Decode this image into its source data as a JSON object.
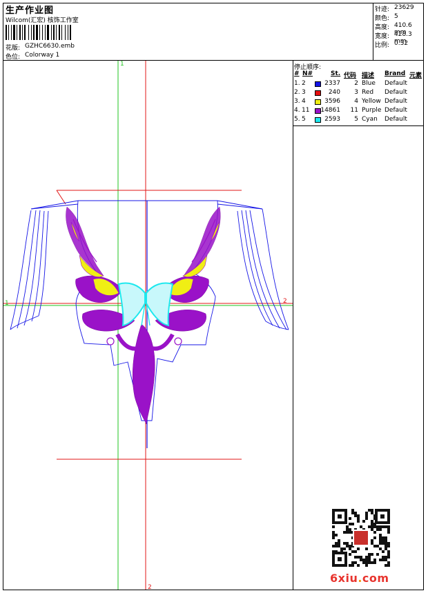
{
  "header": {
    "title": "生产作业图",
    "company": "Wilcom(汇宏) 核饰工作室",
    "design_label": "花版:",
    "design_value": "GZHC6630.emb",
    "colorway_label": "色位:",
    "colorway_value": "Colorway 1"
  },
  "stats": [
    {
      "label": "针迹:",
      "value": "23629"
    },
    {
      "label": "颜色:",
      "value": "5"
    },
    {
      "label": "高度:",
      "value": "410.6 mm"
    },
    {
      "label": "宽度:",
      "value": "428.3 mm"
    },
    {
      "label": "比例:",
      "value": "0.32"
    }
  ],
  "legend": {
    "title": "停止顺序:",
    "headers": {
      "num": "#",
      "n": "N#",
      "st": "St.",
      "code": "代码",
      "desc": "描述",
      "brand": "Brand",
      "element": "元素"
    },
    "rows": [
      {
        "num": "1.",
        "n": "2",
        "color": "#1414e6",
        "st": "2337",
        "code": "2",
        "desc": "Blue",
        "brand": "Default"
      },
      {
        "num": "2.",
        "n": "3",
        "color": "#e60f0f",
        "st": "240",
        "code": "3",
        "desc": "Red",
        "brand": "Default"
      },
      {
        "num": "3.",
        "n": "4",
        "color": "#f0ee14",
        "st": "3596",
        "code": "4",
        "desc": "Yellow",
        "brand": "Default"
      },
      {
        "num": "4.",
        "n": "11",
        "color": "#9a12c8",
        "st": "14861",
        "code": "11",
        "desc": "Purple",
        "brand": "Default"
      },
      {
        "num": "5.",
        "n": "5",
        "color": "#1ee8ee",
        "st": "2593",
        "code": "5",
        "desc": "Cyan",
        "brand": "Default"
      }
    ]
  },
  "canvas": {
    "guide_green_top": "1",
    "guide_green_left": "1",
    "guide_red_right": "2",
    "guide_red_bottom": "2"
  },
  "watermark": {
    "domain_main": "6xiu",
    "domain_dot": ".",
    "domain_tld": "com"
  }
}
